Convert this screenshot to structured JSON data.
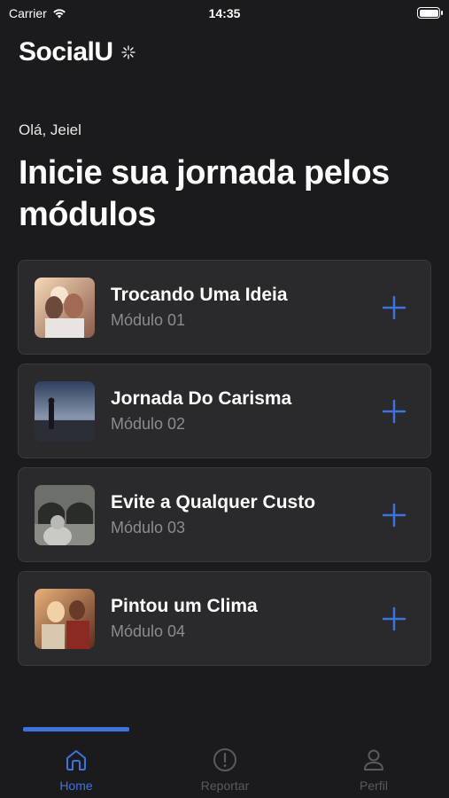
{
  "status": {
    "carrier": "Carrier",
    "time": "14:35"
  },
  "brand": {
    "name": "SocialU"
  },
  "greeting": "Olá, Jeiel",
  "headline": "Inicie sua jornada pelos módulos",
  "modules": [
    {
      "title": "Trocando Uma Ideia",
      "subtitle": "Módulo 01",
      "image": "couple-kissing-sunset"
    },
    {
      "title": "Jornada Do Carisma",
      "subtitle": "Módulo 02",
      "image": "man-silhouette-sea"
    },
    {
      "title": "Evite a Qualquer Custo",
      "subtitle": "Módulo 03",
      "image": "tunnel-traffic"
    },
    {
      "title": "Pintou um Clima",
      "subtitle": "Módulo 04",
      "image": "couple-dinner"
    }
  ],
  "tabs": [
    {
      "label": "Home",
      "icon": "home-icon",
      "active": true
    },
    {
      "label": "Reportar",
      "icon": "alert-circle-icon",
      "active": false
    },
    {
      "label": "Perfil",
      "icon": "user-icon",
      "active": false
    }
  ],
  "colors": {
    "background": "#1b1b1d",
    "card": "#2a2a2c",
    "accent": "#3b74e0",
    "muted": "#8c8c8e",
    "inactive_tab": "#5a5a5c"
  }
}
